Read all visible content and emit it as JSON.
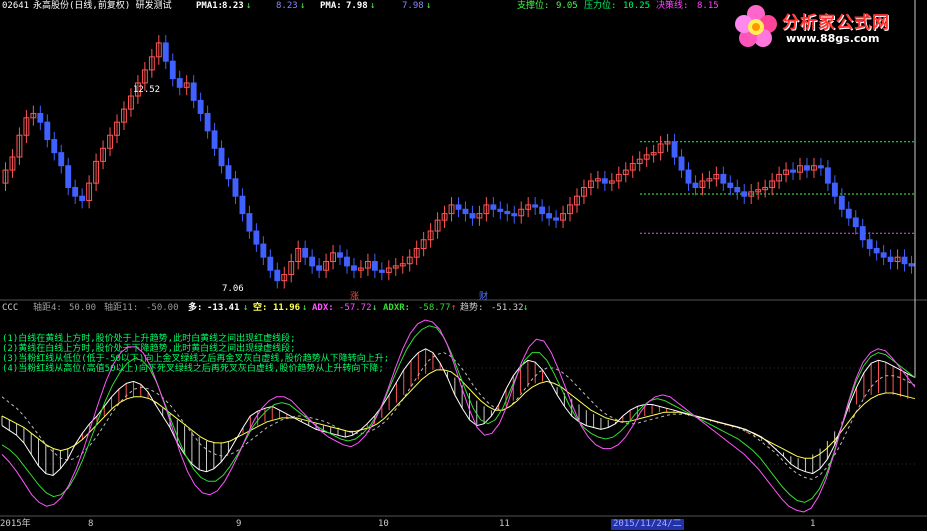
{
  "header": {
    "code": "02641",
    "title": "永高股份(日线,前复权) 研发测试",
    "pma1_label": "PMA1:",
    "pma1_value": "8.23",
    "pma1_arrow": "↓",
    "pma1_value2": "8.23",
    "pma1_arrow2": "↓",
    "pma_label": "PMA:",
    "pma_value": "7.98",
    "pma_arrow": "↓",
    "pma_value2": "7.98",
    "pma_arrow2": "↓",
    "support_label": "支撑位:",
    "support_value": "9.05",
    "pressure_label": "压力位:",
    "pressure_value": "10.25",
    "decision_label": "决策线:",
    "decision_value": "8.15"
  },
  "logo": {
    "title": "分析家公式网",
    "url": "www.88gs.com"
  },
  "price_labels": {
    "high": "12.52",
    "low": "7.06",
    "tag_zhang": "涨",
    "tag_cai": "财"
  },
  "indicator": {
    "name": "CCC",
    "axis4_label": "轴距4:",
    "axis4_value": "50.00",
    "axis11_label": "轴距11:",
    "axis11_value": "-50.00",
    "duo_label": "多:",
    "duo_value": "-13.41",
    "duo_arrow": "↓",
    "kong_label": "空:",
    "kong_value": "11.96",
    "kong_arrow": "↓",
    "adx_label": "ADX:",
    "adx_value": "-57.72",
    "adx_arrow": "↓",
    "adxr_label": "ADXR:",
    "adxr_value": "-58.77",
    "adxr_arrow": "↑",
    "trend_label": "趋势:",
    "trend_value": "-51.32",
    "trend_arrow": "↓"
  },
  "notes": [
    "(1)白线在黄线上方时,股价处于上升趋势,此时白黄线之间出现红虚线段;",
    "(2)黄线在白线上方时,股价处于下降趋势,此时黄白线之间出现绿虚线段;",
    "(3)当粉红线从低位(低于-50以下)向上金叉绿线之后再金叉灰白虚线,股价趋势从下降转向上升;",
    "(4)当粉红线从高位(高值50以上)向下死叉绿线之后再死叉灰白虚线,股价趋势从上升转向下降;"
  ],
  "x_labels": [
    "2015年",
    "8",
    "9",
    "10",
    "11",
    "2015/11/24/二",
    "1"
  ],
  "colors": {
    "bg": "#000000",
    "up": "#ff5555",
    "down": "#4060ff",
    "magenta": "#ee44ee",
    "white": "#ffffff",
    "yellow": "#ffff55",
    "green": "#33dd33",
    "pink": "#ff55ff",
    "cyan": "#55ffff",
    "gray_dash": "#bbbbbb",
    "support_green": "#44ff44",
    "pressure_green": "#00ff66",
    "decision_magenta": "#ff44ff",
    "date_highlight": "#4444ff"
  },
  "chart_data": {
    "type": "candlestick",
    "price_range": [
      6.8,
      13.0
    ],
    "candles_close": [
      9.6,
      9.9,
      10.4,
      10.8,
      10.9,
      10.7,
      10.3,
      10.0,
      9.7,
      9.2,
      9.0,
      8.9,
      9.3,
      9.8,
      10.1,
      10.4,
      10.7,
      11.0,
      11.3,
      11.6,
      11.9,
      12.2,
      12.52,
      12.1,
      11.7,
      11.5,
      11.6,
      11.2,
      10.9,
      10.5,
      10.1,
      9.7,
      9.4,
      9.0,
      8.6,
      8.2,
      7.9,
      7.6,
      7.3,
      7.06,
      7.2,
      7.5,
      7.8,
      7.6,
      7.4,
      7.3,
      7.5,
      7.7,
      7.6,
      7.4,
      7.3,
      7.35,
      7.5,
      7.3,
      7.25,
      7.35,
      7.4,
      7.45,
      7.6,
      7.8,
      8.0,
      8.2,
      8.45,
      8.6,
      8.8,
      8.7,
      8.6,
      8.5,
      8.6,
      8.8,
      8.7,
      8.65,
      8.6,
      8.55,
      8.7,
      8.8,
      8.75,
      8.6,
      8.5,
      8.45,
      8.6,
      8.8,
      9.0,
      9.2,
      9.35,
      9.4,
      9.3,
      9.35,
      9.5,
      9.6,
      9.75,
      9.85,
      9.95,
      10.0,
      10.2,
      10.25,
      9.9,
      9.6,
      9.3,
      9.2,
      9.35,
      9.4,
      9.5,
      9.3,
      9.2,
      9.1,
      9.0,
      9.1,
      9.15,
      9.2,
      9.35,
      9.5,
      9.6,
      9.55,
      9.7,
      9.6,
      9.7,
      9.65,
      9.3,
      9.0,
      8.7,
      8.5,
      8.3,
      8.0,
      7.8,
      7.7,
      7.6,
      7.5,
      7.6,
      7.45,
      7.4
    ],
    "candles_open": [
      9.3,
      9.6,
      9.9,
      10.4,
      10.8,
      10.9,
      10.7,
      10.3,
      10.0,
      9.7,
      9.2,
      9.0,
      8.9,
      9.3,
      9.8,
      10.1,
      10.4,
      10.7,
      11.0,
      11.3,
      11.6,
      11.9,
      12.2,
      12.52,
      12.1,
      11.7,
      11.5,
      11.6,
      11.2,
      10.9,
      10.5,
      10.1,
      9.7,
      9.4,
      9.0,
      8.6,
      8.2,
      7.9,
      7.6,
      7.3,
      7.06,
      7.2,
      7.5,
      7.8,
      7.6,
      7.4,
      7.3,
      7.5,
      7.7,
      7.6,
      7.4,
      7.3,
      7.35,
      7.5,
      7.3,
      7.25,
      7.35,
      7.4,
      7.45,
      7.6,
      7.8,
      8.0,
      8.2,
      8.45,
      8.6,
      8.8,
      8.7,
      8.6,
      8.5,
      8.6,
      8.8,
      8.7,
      8.65,
      8.6,
      8.55,
      8.7,
      8.8,
      8.75,
      8.6,
      8.5,
      8.45,
      8.6,
      8.8,
      9.0,
      9.2,
      9.35,
      9.4,
      9.3,
      9.35,
      9.5,
      9.6,
      9.75,
      9.85,
      9.95,
      10.0,
      10.2,
      10.25,
      9.9,
      9.6,
      9.3,
      9.2,
      9.35,
      9.4,
      9.5,
      9.3,
      9.2,
      9.1,
      9.0,
      9.1,
      9.15,
      9.2,
      9.35,
      9.5,
      9.6,
      9.55,
      9.7,
      9.6,
      9.7,
      9.65,
      9.3,
      9.0,
      8.7,
      8.5,
      8.3,
      8.0,
      7.8,
      7.7,
      7.6,
      7.5,
      7.6,
      7.45
    ],
    "support_level": 9.05,
    "pressure_level": 10.25,
    "decision_level": 8.15,
    "indicator_range": [
      -100,
      100
    ],
    "axis_levels": [
      50,
      -50
    ],
    "white_line": [
      -10,
      -15,
      -20,
      -28,
      -40,
      -52,
      -60,
      -62,
      -55,
      -45,
      -30,
      -18,
      -8,
      0,
      10,
      20,
      28,
      34,
      36,
      33,
      25,
      12,
      0,
      -12,
      -28,
      -40,
      -50,
      -56,
      -58,
      -55,
      -48,
      -38,
      -25,
      -12,
      0,
      5,
      8,
      10,
      6,
      2,
      -2,
      -6,
      -10,
      -14,
      -16,
      -18,
      -20,
      -22,
      -20,
      -15,
      -8,
      0,
      10,
      22,
      35,
      48,
      58,
      66,
      70,
      66,
      55,
      40,
      22,
      8,
      -4,
      -10,
      -8,
      0,
      12,
      28,
      42,
      52,
      58,
      56,
      48,
      36,
      22,
      10,
      0,
      -6,
      -10,
      -12,
      -14,
      -12,
      -8,
      0,
      6,
      10,
      12,
      12,
      10,
      8,
      6,
      4,
      2,
      0,
      -2,
      -4,
      -6,
      -8,
      -10,
      -12,
      -15,
      -18,
      -22,
      -28,
      -35,
      -42,
      -50,
      -55,
      -58,
      -60,
      -55,
      -45,
      -30,
      -10,
      12,
      30,
      45,
      55,
      58,
      56,
      52,
      48,
      44,
      40
    ],
    "green_line": [
      -30,
      -35,
      -42,
      -52,
      -62,
      -72,
      -80,
      -84,
      -82,
      -75,
      -62,
      -45,
      -25,
      -5,
      15,
      32,
      45,
      55,
      60,
      58,
      50,
      35,
      15,
      -5,
      -25,
      -42,
      -55,
      -64,
      -68,
      -68,
      -62,
      -52,
      -40,
      -26,
      -12,
      -2,
      6,
      12,
      14,
      12,
      6,
      0,
      -6,
      -12,
      -16,
      -20,
      -24,
      -26,
      -24,
      -18,
      -10,
      2,
      18,
      36,
      54,
      70,
      82,
      90,
      94,
      92,
      82,
      66,
      46,
      26,
      8,
      -4,
      -8,
      -4,
      8,
      26,
      44,
      58,
      66,
      66,
      58,
      44,
      28,
      12,
      -2,
      -12,
      -18,
      -22,
      -24,
      -22,
      -16,
      -8,
      2,
      10,
      16,
      18,
      16,
      12,
      8,
      4,
      0,
      -4,
      -8,
      -12,
      -16,
      -20,
      -24,
      -30,
      -36,
      -44,
      -54,
      -64,
      -74,
      -82,
      -88,
      -90,
      -86,
      -76,
      -60,
      -38,
      -12,
      14,
      36,
      52,
      62,
      66,
      64,
      58,
      52,
      46,
      40
    ],
    "pink_line": [
      -40,
      -48,
      -58,
      -70,
      -82,
      -90,
      -94,
      -92,
      -85,
      -72,
      -55,
      -34,
      -10,
      14,
      36,
      54,
      66,
      72,
      72,
      66,
      52,
      32,
      10,
      -14,
      -38,
      -58,
      -72,
      -80,
      -82,
      -78,
      -68,
      -54,
      -38,
      -20,
      -4,
      8,
      16,
      20,
      20,
      16,
      8,
      0,
      -8,
      -16,
      -22,
      -26,
      -30,
      -32,
      -28,
      -20,
      -8,
      8,
      28,
      50,
      70,
      86,
      96,
      100,
      98,
      90,
      74,
      52,
      28,
      6,
      -12,
      -20,
      -18,
      -8,
      10,
      34,
      56,
      72,
      80,
      78,
      66,
      48,
      28,
      8,
      -10,
      -22,
      -30,
      -34,
      -34,
      -30,
      -22,
      -10,
      4,
      14,
      20,
      22,
      20,
      14,
      8,
      2,
      -4,
      -10,
      -16,
      -22,
      -28,
      -34,
      -40,
      -48,
      -56,
      -66,
      -76,
      -86,
      -94,
      -98,
      -100,
      -96,
      -84,
      -66,
      -42,
      -14,
      14,
      38,
      56,
      66,
      70,
      68,
      60,
      50,
      40,
      30
    ],
    "yellow_line": [
      0,
      -4,
      -8,
      -12,
      -18,
      -24,
      -30,
      -34,
      -36,
      -34,
      -30,
      -24,
      -16,
      -8,
      0,
      8,
      14,
      18,
      20,
      20,
      18,
      14,
      8,
      2,
      -4,
      -10,
      -16,
      -22,
      -26,
      -28,
      -28,
      -26,
      -22,
      -18,
      -14,
      -10,
      -6,
      -4,
      -2,
      -2,
      -2,
      -4,
      -6,
      -8,
      -10,
      -12,
      -14,
      -16,
      -16,
      -14,
      -12,
      -8,
      -2,
      6,
      14,
      22,
      30,
      38,
      44,
      48,
      48,
      46,
      40,
      32,
      24,
      16,
      10,
      6,
      6,
      10,
      16,
      24,
      30,
      34,
      36,
      34,
      30,
      24,
      18,
      12,
      6,
      2,
      -2,
      -4,
      -6,
      -6,
      -4,
      -2,
      0,
      2,
      4,
      4,
      4,
      2,
      0,
      -2,
      -4,
      -6,
      -8,
      -10,
      -12,
      -14,
      -18,
      -22,
      -26,
      -30,
      -34,
      -38,
      -42,
      -44,
      -44,
      -40,
      -34,
      -26,
      -16,
      -6,
      4,
      12,
      18,
      22,
      24,
      24,
      22,
      20,
      18
    ],
    "gray_dash_line": [
      20,
      14,
      8,
      0,
      -10,
      -20,
      -30,
      -38,
      -44,
      -46,
      -44,
      -38,
      -30,
      -20,
      -8,
      4,
      14,
      22,
      28,
      30,
      28,
      24,
      18,
      10,
      0,
      -10,
      -20,
      -30,
      -36,
      -40,
      -42,
      -40,
      -36,
      -30,
      -24,
      -18,
      -12,
      -8,
      -4,
      -2,
      0,
      0,
      -2,
      -4,
      -6,
      -10,
      -14,
      -16,
      -18,
      -18,
      -16,
      -12,
      -6,
      2,
      12,
      24,
      36,
      48,
      58,
      64,
      66,
      62,
      54,
      44,
      32,
      22,
      14,
      8,
      6,
      10,
      18,
      28,
      38,
      46,
      50,
      50,
      46,
      40,
      32,
      24,
      16,
      8,
      2,
      -2,
      -6,
      -8,
      -8,
      -6,
      -4,
      -2,
      0,
      2,
      2,
      2,
      0,
      -2,
      -4,
      -6,
      -8,
      -10,
      -12,
      -16,
      -20,
      -26,
      -32,
      -38,
      -46,
      -54,
      -60,
      -64,
      -66,
      -62,
      -54,
      -42,
      -28,
      -12,
      4,
      18,
      30,
      38,
      42,
      42,
      40,
      36,
      32
    ]
  }
}
